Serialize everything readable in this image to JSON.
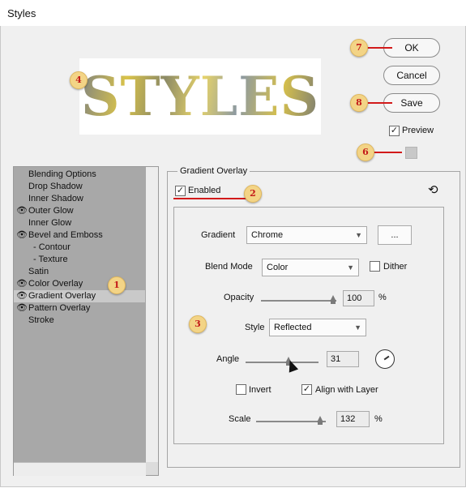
{
  "window": {
    "title": "Styles"
  },
  "preview": {
    "text": "STYLES"
  },
  "buttons": {
    "ok": "OK",
    "cancel": "Cancel",
    "save": "Save"
  },
  "preview_checkbox": {
    "label": "Preview",
    "checked": true
  },
  "styles_list": [
    {
      "label": "Blending Options",
      "eye": false
    },
    {
      "label": "Drop Shadow",
      "eye": false
    },
    {
      "label": "Inner Shadow",
      "eye": false
    },
    {
      "label": "Outer Glow",
      "eye": true
    },
    {
      "label": "Inner Glow",
      "eye": false
    },
    {
      "label": "Bevel and Emboss",
      "eye": true
    },
    {
      "label": "- Contour",
      "eye": false
    },
    {
      "label": "- Texture",
      "eye": false
    },
    {
      "label": "Satin",
      "eye": false
    },
    {
      "label": "Color Overlay",
      "eye": true
    },
    {
      "label": "Gradient Overlay",
      "eye": true,
      "selected": true
    },
    {
      "label": "Pattern Overlay",
      "eye": true
    },
    {
      "label": "Stroke",
      "eye": false
    }
  ],
  "panel": {
    "title": "Gradient Overlay",
    "enabled_label": "Enabled",
    "gradient_label": "Gradient",
    "gradient_value": "Chrome",
    "more_button": "...",
    "blend_mode_label": "Blend Mode",
    "blend_mode_value": "Color",
    "dither_label": "Dither",
    "opacity_label": "Opacity",
    "opacity_value": "100",
    "opacity_unit": "%",
    "style_label": "Style",
    "style_value": "Reflected",
    "angle_label": "Angle",
    "angle_value": "31",
    "invert_label": "Invert",
    "align_label": "Align with Layer",
    "scale_label": "Scale",
    "scale_value": "132",
    "scale_unit": "%"
  },
  "annotations": {
    "b1": "1",
    "b2": "2",
    "b3": "3",
    "b4": "4",
    "b6": "6",
    "b7": "7",
    "b8": "8"
  },
  "colors": {
    "annotation_red": "#d21a1a",
    "badge_fill": "#f3d486",
    "list_bg": "#a8a8a8"
  },
  "icons": {
    "eye": "eye-icon",
    "reset": "reset-icon",
    "check": "checkmark-icon",
    "dropdown": "chevron-down-icon"
  }
}
